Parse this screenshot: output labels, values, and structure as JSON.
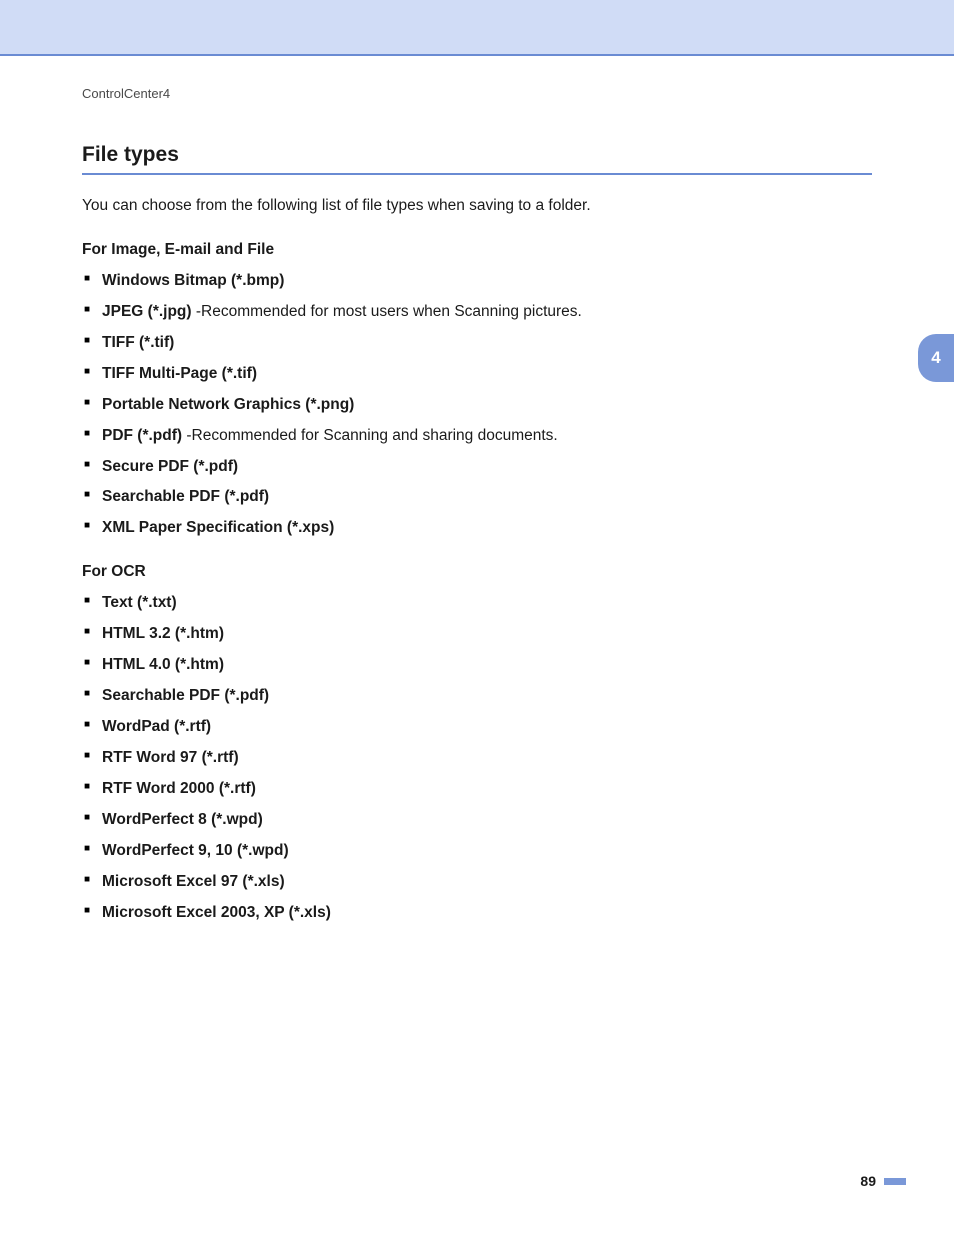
{
  "header": {
    "label": "ControlCenter4"
  },
  "section": {
    "title": "File types",
    "intro": "You can choose from the following list of file types when saving to a folder."
  },
  "group1": {
    "heading": "For Image, E-mail and File",
    "items": [
      {
        "bold": "Windows Bitmap (*.bmp)",
        "rest": ""
      },
      {
        "bold": "JPEG (*.jpg)",
        "rest": " -Recommended for most users when Scanning pictures."
      },
      {
        "bold": "TIFF (*.tif)",
        "rest": ""
      },
      {
        "bold": "TIFF Multi-Page (*.tif)",
        "rest": ""
      },
      {
        "bold": "Portable Network Graphics (*.png)",
        "rest": ""
      },
      {
        "bold": "PDF (*.pdf)",
        "rest": " -Recommended for Scanning and sharing documents."
      },
      {
        "bold": "Secure PDF (*.pdf)",
        "rest": ""
      },
      {
        "bold": "Searchable PDF (*.pdf)",
        "rest": ""
      },
      {
        "bold": "XML Paper Specification (*.xps)",
        "rest": ""
      }
    ]
  },
  "group2": {
    "heading": "For OCR",
    "items": [
      {
        "bold": "Text (*.txt)",
        "rest": ""
      },
      {
        "bold": "HTML 3.2 (*.htm)",
        "rest": ""
      },
      {
        "bold": "HTML 4.0 (*.htm)",
        "rest": ""
      },
      {
        "bold": "Searchable PDF (*.pdf)",
        "rest": ""
      },
      {
        "bold": "WordPad (*.rtf)",
        "rest": ""
      },
      {
        "bold": "RTF Word 97 (*.rtf)",
        "rest": ""
      },
      {
        "bold": "RTF Word 2000 (*.rtf)",
        "rest": ""
      },
      {
        "bold": "WordPerfect 8 (*.wpd)",
        "rest": ""
      },
      {
        "bold": "WordPerfect 9, 10 (*.wpd)",
        "rest": ""
      },
      {
        "bold": "Microsoft Excel 97 (*.xls)",
        "rest": ""
      },
      {
        "bold": "Microsoft Excel 2003, XP (*.xls)",
        "rest": ""
      }
    ]
  },
  "chapter": {
    "number": "4"
  },
  "footer": {
    "page": "89"
  }
}
